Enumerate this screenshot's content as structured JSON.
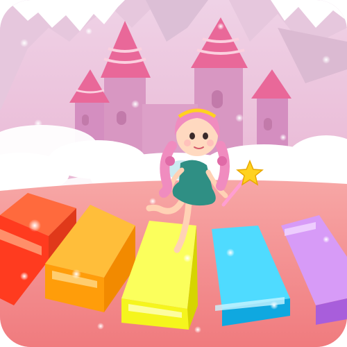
{
  "scene": {
    "sky_color": "#f4a6c8",
    "mountain_color": "#e7cde0",
    "mountain_snow_color": "#ffffff",
    "castle_wall_color": "#d98fc0",
    "castle_roof_color": "#e85a8e",
    "cloud_color": "#ffffff",
    "floor_color": "#f28b8b"
  },
  "character": {
    "role": "fairy",
    "hair_color": "#f08cbf",
    "dress_color": "#2f8f84",
    "wand_star_color": "#ffd21f"
  },
  "tiles": [
    {
      "color_name": "red",
      "color": "#ff3b1f"
    },
    {
      "color_name": "orange",
      "color": "#ff9d0a"
    },
    {
      "color_name": "yellow",
      "color": "#f5f51d"
    },
    {
      "color_name": "blue",
      "color": "#1ac8f5"
    },
    {
      "color_name": "purple",
      "color": "#c77cf2"
    }
  ]
}
